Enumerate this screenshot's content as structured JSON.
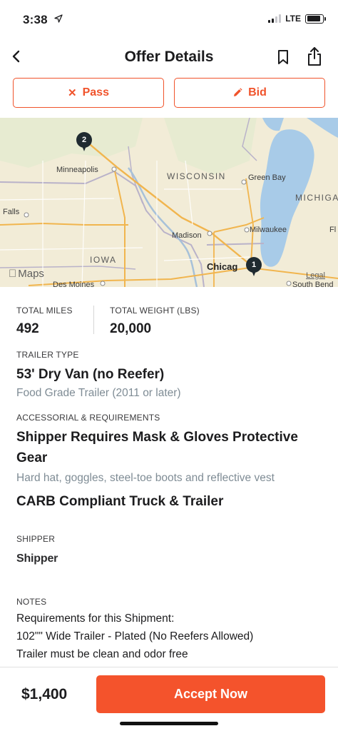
{
  "status_bar": {
    "time": "3:38",
    "network": "LTE"
  },
  "nav": {
    "title": "Offer Details"
  },
  "actions": {
    "pass_label": "Pass",
    "bid_label": "Bid",
    "accent_color": "#f0532b"
  },
  "map": {
    "labels": {
      "minneapolis": "Minneapolis",
      "wisconsin": "WISCONSIN",
      "green_bay": "Green Bay",
      "michigan": "MICHIGA",
      "falls": "Falls",
      "madison": "Madison",
      "milwaukee": "Milwaukee",
      "iowa": "IOWA",
      "chicago": "Chicag",
      "des_moines": "Des Moines",
      "south_bend": "South Bend",
      "edge_f": "Fl"
    },
    "pins": [
      {
        "label": "2"
      },
      {
        "label": "1"
      }
    ],
    "attribution": "Maps",
    "legal": "Legal"
  },
  "details": {
    "total_miles_caption": "TOTAL MILES",
    "total_miles": "492",
    "total_weight_caption": "TOTAL WEIGHT (LBS)",
    "total_weight": "20,000",
    "trailer_caption": "TRAILER TYPE",
    "trailer_type": "53' Dry Van (no Reefer)",
    "trailer_sub": "Food Grade Trailer (2011 or later)",
    "accessorial_caption": "ACCESSORIAL & REQUIREMENTS",
    "req1_title": "Shipper Requires Mask & Gloves Protective Gear",
    "req1_sub": "Hard hat, goggles, steel-toe boots and reflective vest",
    "req2_title": "CARB Compliant Truck & Trailer",
    "shipper_caption": "SHIPPER",
    "shipper_name": "Shipper",
    "notes_caption": "NOTES",
    "notes_lines": [
      "Requirements for this Shipment:",
      "102\"\" Wide Trailer - Plated (No Reefers Allowed)",
      "Trailer must be clean and odor free"
    ]
  },
  "bottom": {
    "price": "$1,400",
    "accept_label": "Accept Now"
  }
}
